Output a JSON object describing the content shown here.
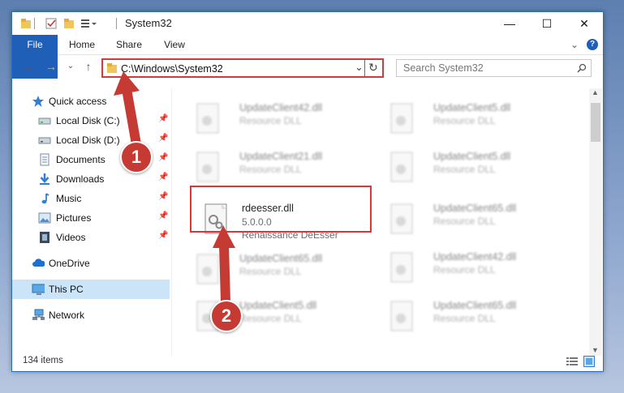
{
  "window": {
    "title": "System32",
    "minimize": "—",
    "maximize": "☐",
    "close": "✕"
  },
  "ribbon": {
    "tabs": [
      "File",
      "Home",
      "Share",
      "View"
    ],
    "expand": "⌄",
    "help": "?"
  },
  "address_bar": {
    "path": "C:\\Windows\\System32",
    "dropdown": "⌄",
    "refresh": "↻"
  },
  "search": {
    "placeholder": "Search System32",
    "icon": "search-icon"
  },
  "sidebar": {
    "items": [
      {
        "label": "Quick access",
        "icon": "star-icon",
        "pinned": false
      },
      {
        "label": "Local Disk (C:)",
        "icon": "drive-icon",
        "pinned": true
      },
      {
        "label": "Local Disk (D:)",
        "icon": "drive-icon",
        "pinned": true
      },
      {
        "label": "Documents",
        "icon": "documents-icon",
        "pinned": true
      },
      {
        "label": "Downloads",
        "icon": "download-icon",
        "pinned": true
      },
      {
        "label": "Music",
        "icon": "music-icon",
        "pinned": true
      },
      {
        "label": "Pictures",
        "icon": "pictures-icon",
        "pinned": true
      },
      {
        "label": "Videos",
        "icon": "videos-icon",
        "pinned": true
      },
      {
        "label": "OneDrive",
        "icon": "cloud-icon",
        "pinned": false
      },
      {
        "label": "This PC",
        "icon": "computer-icon",
        "pinned": false,
        "selected": true
      },
      {
        "label": "Network",
        "icon": "network-icon",
        "pinned": false
      }
    ]
  },
  "files": {
    "left": [
      {
        "name": "UpdateClient42.dll",
        "desc": "Resource DLL"
      },
      {
        "name": "UpdateClient21.dll",
        "desc": "Resource DLL"
      },
      {
        "name": "rdeesser.dll",
        "version": "5.0.0.0",
        "desc": "Renaissance DeEsser",
        "highlighted": true
      },
      {
        "name": "UpdateClient65.dll",
        "desc": "Resource DLL"
      },
      {
        "name": "UpdateClient5.dll",
        "desc": "Resource DLL"
      }
    ],
    "right": [
      {
        "name": "UpdateClient5.dll",
        "desc": "Resource DLL"
      },
      {
        "name": "UpdateClient5.dll",
        "desc": "Resource DLL"
      },
      {
        "name": "UpdateClient65.dll",
        "desc": "Resource DLL"
      },
      {
        "name": "UpdateClient42.dll",
        "desc": "Resource DLL"
      },
      {
        "name": "UpdateClient65.dll",
        "desc": "Resource DLL"
      }
    ]
  },
  "status_bar": {
    "item_count": "134 items"
  },
  "annotations": {
    "step1": "1",
    "step2": "2"
  },
  "colors": {
    "accent": "#1f5fb8",
    "highlight_border": "#d23b3b",
    "callout": "#c63a34",
    "selected_bg": "#cce4f7"
  }
}
